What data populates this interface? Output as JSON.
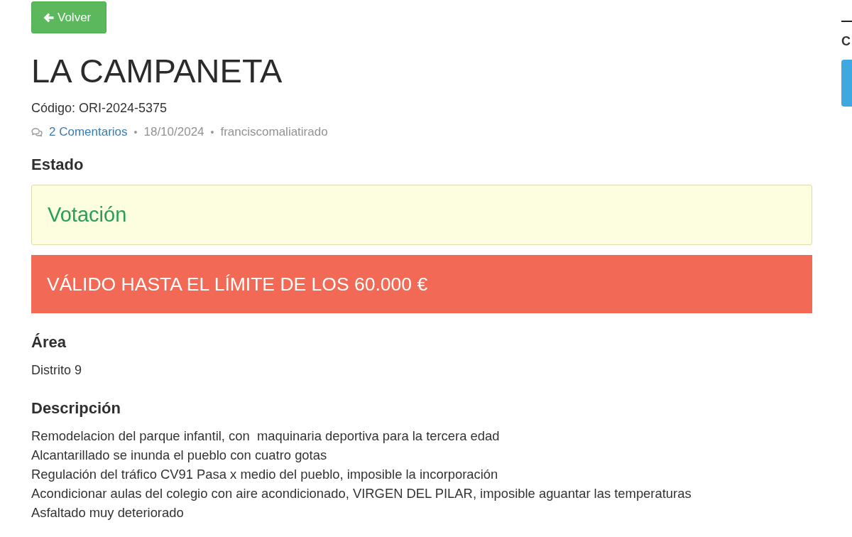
{
  "back_button": {
    "label": "Volver"
  },
  "title": "LA CAMPANETA",
  "code": "Código: ORI-2024-5375",
  "meta": {
    "comments": "2 Comentarios",
    "separator_1": "•",
    "date": "18/10/2024",
    "separator_2": "•",
    "author": "franciscomaliatirado"
  },
  "status": {
    "heading": "Estado",
    "value": "Votación"
  },
  "notice": "VÁLIDO HASTA EL LÍMITE DE LOS 60.000 €",
  "area": {
    "heading": "Área",
    "value": "Distrito 9"
  },
  "description": {
    "heading": "Descripción",
    "lines": [
      "Remodelacion del parque infantil, con  maquinaria deportiva para la tercera edad",
      "Alcantarillado se inunda el pueblo con cuatro gotas",
      "Regulación del tráfico CV91 Pasa x medio del pueblo, imposible la incorporación",
      "Acondicionar aulas del colegio con aire acondicionado, VIRGEN DEL PILAR, imposible aguantar las temperaturas",
      "Asfaltado muy deteriorado"
    ]
  },
  "sidebar": {
    "heading": "C"
  }
}
